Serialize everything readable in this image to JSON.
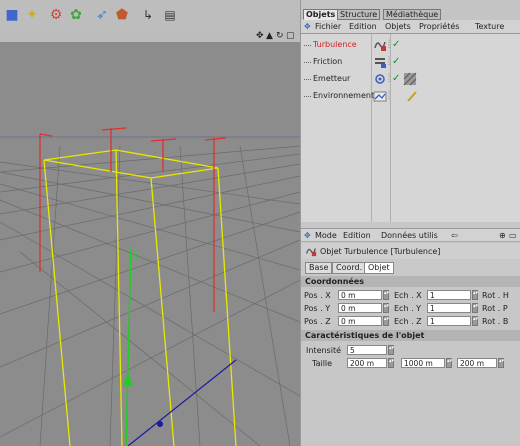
{
  "toolbar": {
    "icons": [
      "cube-icon",
      "magic-icon",
      "gear-icon",
      "flower-icon",
      "cursor-icon",
      "polygon-icon",
      "render-arrow-icon",
      "render-window-icon"
    ]
  },
  "viewport": {
    "controls": [
      "✥",
      "▲",
      "↻",
      "▢"
    ]
  },
  "tabs": [
    {
      "label": "Objets",
      "active": true
    },
    {
      "label": "Structure",
      "active": false
    },
    {
      "label": "Médiathèque",
      "active": false
    }
  ],
  "object_manager": {
    "menu": [
      "Fichier",
      "Edition",
      "Objets",
      "Propriétés",
      "Texture"
    ],
    "objects": [
      {
        "name": "Turbulence",
        "selected": true
      },
      {
        "name": "Friction",
        "selected": false
      },
      {
        "name": "Emetteur",
        "selected": false
      },
      {
        "name": "Environnement",
        "selected": false
      }
    ]
  },
  "attributes": {
    "menu": [
      "Mode",
      "Edition",
      "Données utilis"
    ],
    "title": "Objet Turbulence [Turbulence]",
    "tabs": [
      {
        "label": "Base",
        "active": false
      },
      {
        "label": "Coord.",
        "active": false
      },
      {
        "label": "Objet",
        "active": true
      }
    ],
    "coordinates_title": "Coordonnées",
    "coords": [
      {
        "pos_label": "Pos . X",
        "pos_value": "0 m",
        "ech_label": "Ech . X",
        "ech_value": "1",
        "rot_label": "Rot . H"
      },
      {
        "pos_label": "Pos . Y",
        "pos_value": "0 m",
        "ech_label": "Ech . Y",
        "ech_value": "1",
        "rot_label": "Rot . P"
      },
      {
        "pos_label": "Pos . Z",
        "pos_value": "0 m",
        "ech_label": "Ech . Z",
        "ech_value": "1",
        "rot_label": "Rot . B"
      }
    ],
    "object_section_title": "Caractéristiques de l'objet",
    "intensity_label": "Intensité",
    "intensity_value": "5",
    "size_label": "Taille",
    "size_values": [
      "200 m",
      "1000 m",
      "200 m"
    ]
  },
  "colors": {
    "selected_object": "#d42020",
    "check_green": "#188f2b",
    "bbox_yellow": "#e8e800",
    "marker_red": "#e03030",
    "axis_green": "#22cc22",
    "axis_blue": "#1a1aa0"
  }
}
